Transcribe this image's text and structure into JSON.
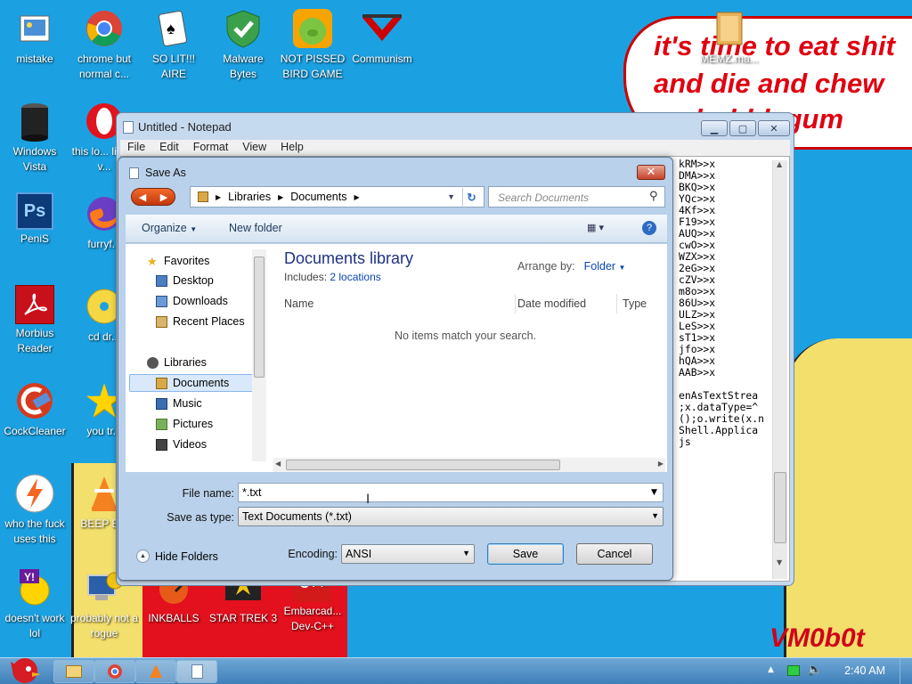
{
  "wallpaper": {
    "lines": [
      "it's time to eat shit",
      "and die and chew",
      "bubblegum"
    ],
    "signature": "VM0b0t"
  },
  "desktop_icons": [
    {
      "label": "mistake",
      "icon": "image-file-icon"
    },
    {
      "label": "chrome but normal c...",
      "icon": "chrome-icon"
    },
    {
      "label": "SO LIT!!! AIRE",
      "icon": "solitaire-icon"
    },
    {
      "label": "Malware Bytes",
      "icon": "shield-icon"
    },
    {
      "label": "NOT PISSED BIRD GAME",
      "icon": "pig-icon"
    },
    {
      "label": "Communism",
      "icon": "communism-logo-icon"
    },
    {
      "label": "Windows Vista",
      "icon": "trash-can-icon"
    },
    {
      "label": "this lo... like a v...",
      "icon": "opera-icon"
    },
    {
      "label": "PeniS",
      "icon": "photoshop-icon"
    },
    {
      "label": "furryf...",
      "icon": "firefox-icon"
    },
    {
      "label": "Morbius Reader",
      "icon": "pdf-reader-icon"
    },
    {
      "label": "cd dr...",
      "icon": "cd-icon"
    },
    {
      "label": "CockCleaner",
      "icon": "ccleaner-icon"
    },
    {
      "label": "you tr...",
      "icon": "star-icon"
    },
    {
      "label": "who the fuck uses this",
      "icon": "winamp-icon"
    },
    {
      "label": "BEEP B...",
      "icon": "vlc-icon"
    },
    {
      "label": "doesn't work lol",
      "icon": "yahoo-icon"
    },
    {
      "label": "probably not a rogue",
      "icon": "computer-gear-icon"
    },
    {
      "label": "INKBALLS",
      "icon": "inkball-icon"
    },
    {
      "label": "STAR TREK 3",
      "icon": "star-trek-icon"
    },
    {
      "label": "Embarcad... Dev-C++",
      "icon": "devcpp-icon"
    },
    {
      "label": "MEMZ.ma...",
      "icon": "folder-icon"
    }
  ],
  "notepad": {
    "title": "Untitled - Notepad",
    "menu": [
      "File",
      "Edit",
      "Format",
      "View",
      "Help"
    ],
    "text": "kRM>>x\nDMA>>x\nBKQ>>x\nYQc>>x\n4Kf>>x\nF19>>x\nAUQ>>x\ncwO>>x\nWZX>>x\n2eG>>x\ncZV>>x\nm8o>>x\n86U>>x\nULZ>>x\nLeS>>x\nsT1>>x\njfo>>x\nhQA>>x\nAAB>>x\n\nenAsTextStrea\n;x.dataType=^\n();o.write(x.n\nShell.Applica\njs"
  },
  "save_as": {
    "title": "Save As",
    "address": [
      "Libraries",
      "Documents"
    ],
    "search_placeholder": "Search Documents",
    "toolbar": {
      "organize": "Organize",
      "new_folder": "New folder"
    },
    "tree": {
      "favorites": "Favorites",
      "favorites_items": [
        "Desktop",
        "Downloads",
        "Recent Places"
      ],
      "libraries": "Libraries",
      "library_items": [
        "Documents",
        "Music",
        "Pictures",
        "Videos"
      ],
      "selected": "Documents"
    },
    "library": {
      "title": "Documents library",
      "includes_label": "Includes:",
      "includes_link": "2 locations",
      "arrange_label": "Arrange by:",
      "arrange_value": "Folder"
    },
    "columns": [
      "Name",
      "Date modified",
      "Type"
    ],
    "empty_message": "No items match your search.",
    "file_name_label": "File name:",
    "file_name_value": "*.txt",
    "save_type_label": "Save as type:",
    "save_type_value": "Text Documents (*.txt)",
    "hide_folders": "Hide Folders",
    "encoding_label": "Encoding:",
    "encoding_value": "ANSI",
    "save_button": "Save",
    "cancel_button": "Cancel"
  },
  "taskbar": {
    "clock": "2:40 AM"
  }
}
